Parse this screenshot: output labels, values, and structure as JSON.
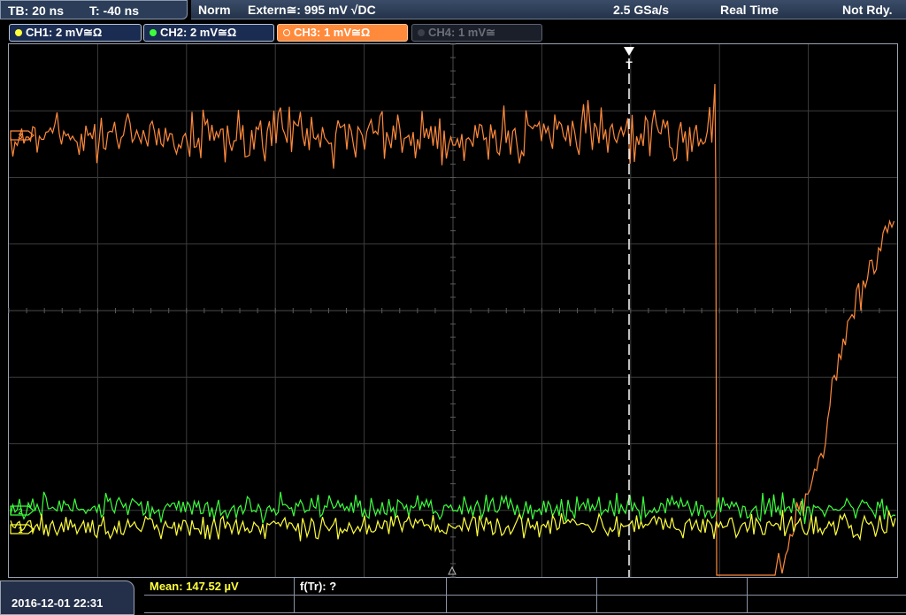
{
  "status_bar": {
    "timebase": "TB: 20 ns",
    "trigger_offset": "T: -40 ns",
    "trigger_mode": "Norm",
    "trigger_source": "Extern≅: 995 mV √DC",
    "sample_rate": "2.5 GSa/s",
    "acq_mode": "Real Time",
    "acq_state": "Not Rdy."
  },
  "channels": [
    {
      "label": "CH1: 2 mV≅Ω",
      "color": "#ffff3c",
      "active": true
    },
    {
      "label": "CH2: 2 mV≅Ω",
      "color": "#3cff3c",
      "active": true
    },
    {
      "label": "CH3: 1 mV≅Ω",
      "color": "#ff8a3c",
      "active": true,
      "selected": true
    },
    {
      "label": "CH4: 1 mV≅",
      "color": "#5d6270",
      "active": false
    }
  ],
  "trigger_marker": "T",
  "ref_markers": {
    "ch3": "3",
    "ch2": "2",
    "ch1": "1"
  },
  "measurements": {
    "mean": "Mean: 147.52 µV",
    "f_tr": "f(Tr): ?"
  },
  "datetime": "2016-12-01 22:31",
  "colors": {
    "ch1": "#ffff3c",
    "ch2": "#3cff3c",
    "ch3": "#ff8a3c",
    "grid": "#3a3a3a",
    "trigger_line": "#ffffff"
  }
}
